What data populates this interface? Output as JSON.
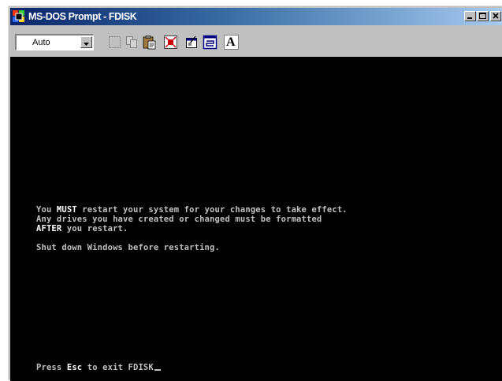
{
  "window": {
    "title": "MS-DOS Prompt - FDISK"
  },
  "toolbar": {
    "font_size_value": "Auto",
    "buttons": [
      "mark-icon",
      "copy-icon",
      "paste-icon",
      "fullscreen-icon",
      "properties-icon",
      "background-icon",
      "font-icon"
    ],
    "font_button_label": "A"
  },
  "console": {
    "line1_pre": "You ",
    "line1_bold": "MUST",
    "line1_post": " restart your system for your changes to take effect.",
    "line2": "Any drives you have created or changed must be formatted",
    "line3_bold": "AFTER",
    "line3_post": " you restart.",
    "line4": "Shut down Windows before restarting.",
    "prompt_pre": "Press ",
    "prompt_key": "Esc",
    "prompt_post": " to exit FDISK"
  },
  "colors": {
    "title_gradient_start": "#0a246a",
    "title_gradient_end": "#a6caf0",
    "console_background": "#000000",
    "console_text": "#c0c0c0"
  }
}
